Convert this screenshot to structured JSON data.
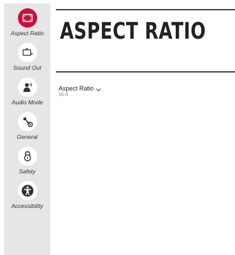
{
  "sidebar": {
    "items": [
      {
        "label": "Aspect Ratio",
        "icon": "aspect-ratio-icon",
        "active": true
      },
      {
        "label": "Sound Out",
        "icon": "sound-out-icon",
        "active": false
      },
      {
        "label": "Audio Mode",
        "icon": "audio-mode-icon",
        "active": false
      },
      {
        "label": "General",
        "icon": "general-icon",
        "active": false
      },
      {
        "label": "Safety",
        "icon": "safety-icon",
        "active": false
      },
      {
        "label": "Accessibility",
        "icon": "accessibility-icon",
        "active": false
      }
    ]
  },
  "main": {
    "title": "ASPECT RATIO",
    "setting": {
      "name": "Aspect Ratio",
      "value": "16:9"
    }
  },
  "colors": {
    "accent": "#c8103e",
    "sidebar_bg": "#e6e6e6",
    "rule": "#4a4a4a"
  }
}
